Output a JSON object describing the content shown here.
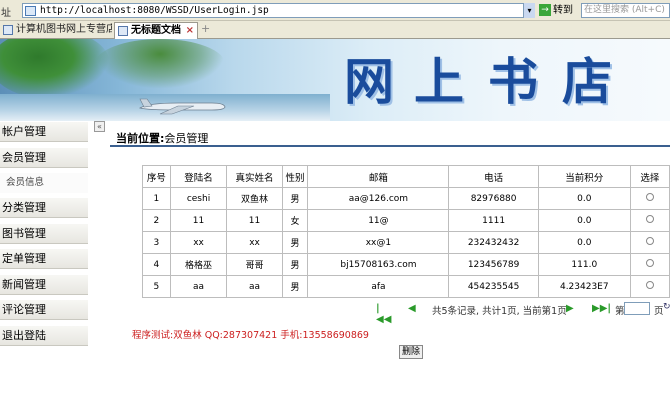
{
  "browser": {
    "addr_label": "址",
    "url": "http://localhost:8080/WSSD/UserLogin.jsp",
    "go_label": "转到",
    "search_placeholder": "在这里搜索 (Alt+C)",
    "tabs": [
      {
        "label": "计算机图书网上专营店"
      },
      {
        "label": "无标题文档"
      }
    ]
  },
  "banner": {
    "title_chars": [
      "网",
      "上",
      "书",
      "店"
    ]
  },
  "sidebar": {
    "items": [
      {
        "label": "帐户管理"
      },
      {
        "label": "会员管理"
      },
      {
        "label": "会员信息"
      },
      {
        "label": "分类管理"
      },
      {
        "label": "图书管理"
      },
      {
        "label": "定单管理"
      },
      {
        "label": "新闻管理"
      },
      {
        "label": "评论管理"
      },
      {
        "label": "退出登陆"
      }
    ],
    "splitter_glyph": "«"
  },
  "main": {
    "crumb_label": "当前位置:",
    "crumb_value": "会员管理",
    "table": {
      "headers": [
        "序号",
        "登陆名",
        "真实姓名",
        "性别",
        "邮箱",
        "电话",
        "当前积分",
        "选择"
      ],
      "rows": [
        [
          "1",
          "ceshi",
          "双鱼林",
          "男",
          "aa@126.com",
          "82976880",
          "0.0"
        ],
        [
          "2",
          "11",
          "11",
          "女",
          "11@",
          "1111",
          "0.0"
        ],
        [
          "3",
          "xx",
          "xx",
          "男",
          "xx@1",
          "232432432",
          "0.0"
        ],
        [
          "4",
          "格格巫",
          "哥哥",
          "男",
          "bj15708163.com",
          "123456789",
          "111.0"
        ],
        [
          "5",
          "aa",
          "aa",
          "男",
          "afa",
          "454235545",
          "4.23423E7"
        ]
      ]
    },
    "pager": {
      "summary": "共5条记录, 共计1页, 当前第1页",
      "page_label": "第",
      "page_suffix": "页"
    },
    "info_text": "程序测试:双鱼林 QQ:287307421 手机:13558690869",
    "delete_label": "删除"
  },
  "colors": {
    "accent": "#1a4c9c",
    "info_red": "#cc1f1f",
    "pager_green": "#2a9a2a"
  }
}
